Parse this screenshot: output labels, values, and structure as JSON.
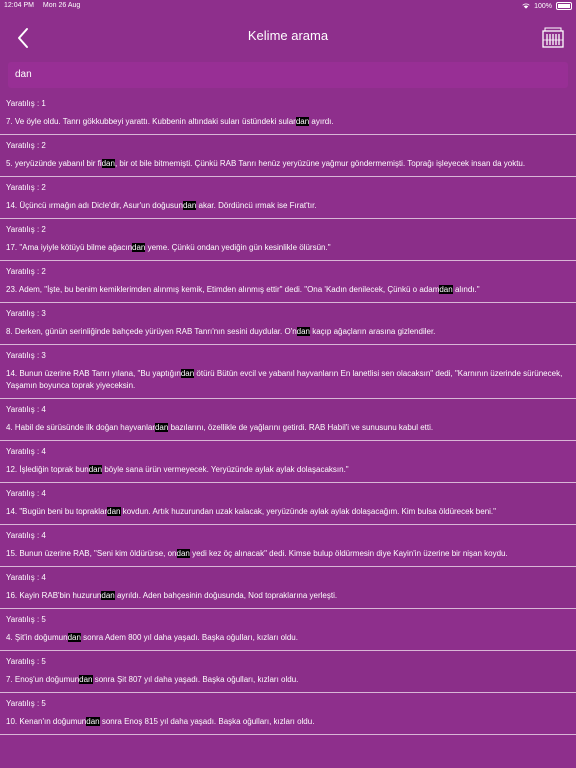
{
  "status": {
    "time": "12:04 PM",
    "date": "Mon 26 Aug",
    "battery": "100%"
  },
  "nav": {
    "title": "Kelime arama"
  },
  "search": {
    "value": "dan"
  },
  "results": [
    {
      "ref": "Yaratılış : 1",
      "pre": "7. Ve öyle oldu. Tanrı gökkubbeyi yarattı. Kubbenin altındaki suları üstündeki sular",
      "match": "dan",
      "post": " ayırdı."
    },
    {
      "ref": "Yaratılış : 2",
      "pre": "5. yeryüzünde yabanıl bir fi",
      "match": "dan",
      "post": ", bir ot bile bitmemişti. Çünkü RAB Tanrı henüz yeryüzüne yağmur göndermemişti. Toprağı işleyecek insan da yoktu."
    },
    {
      "ref": "Yaratılış : 2",
      "pre": "14. Üçüncü ırmağın adı Dicle'dir, Asur'un doğusun",
      "match": "dan",
      "post": " akar. Dördüncü ırmak ise Fırat'tır."
    },
    {
      "ref": "Yaratılış : 2",
      "pre": "17. \"Ama iyiyle kötüyü bilme ağacın",
      "match": "dan",
      "post": " yeme. Çünkü ondan yediğin gün kesinlikle ölürsün.\""
    },
    {
      "ref": "Yaratılış : 2",
      "pre": "23. Adem, \"İşte, bu benim kemiklerimden alınmış kemik, Etimden alınmış ettir\" dedi. \"Ona 'Kadın denilecek, Çünkü o adam",
      "match": "dan",
      "post": " alındı.\""
    },
    {
      "ref": "Yaratılış : 3",
      "pre": "8. Derken, günün serinliğinde bahçede yürüyen RAB Tanrı'nın sesini duydular. O'n",
      "match": "dan",
      "post": " kaçıp ağaçların arasına gizlendiler."
    },
    {
      "ref": "Yaratılış : 3",
      "pre": "14. Bunun üzerine RAB Tanrı yılana, \"Bu yaptığın",
      "match": "dan",
      "post": " ötürü Bütün evcil ve yabanıl hayvanların En lanetlisi sen olacaksın\" dedi, \"Karnının üzerinde sürünecek, Yaşamın boyunca toprak yiyeceksin."
    },
    {
      "ref": "Yaratılış : 4",
      "pre": "4. Habil de sürüsünde ilk doğan hayvanlar",
      "match": "dan",
      "post": " bazılarını, özellikle de yağlarını getirdi. RAB Habil'i ve sunusunu kabul etti."
    },
    {
      "ref": "Yaratılış : 4",
      "pre": "12. İşlediğin toprak bun",
      "match": "dan",
      "post": " böyle sana ürün vermeyecek. Yeryüzünde aylak aylak dolaşacaksın.\""
    },
    {
      "ref": "Yaratılış : 4",
      "pre": "14. \"Bugün beni bu topraklar",
      "match": "dan",
      "post": " kovdun. Artık huzurundan uzak kalacak, yeryüzünde aylak aylak dolaşacağım. Kim bulsa öldürecek beni.\""
    },
    {
      "ref": "Yaratılış : 4",
      "pre": "15. Bunun üzerine RAB, \"Seni kim öldürürse, on",
      "match": "dan",
      "post": " yedi kez öç alınacak\" dedi. Kimse bulup öldürmesin diye Kayin'in üzerine bir nişan koydu."
    },
    {
      "ref": "Yaratılış : 4",
      "pre": "16. Kayin RAB'bin huzurun",
      "match": "dan",
      "post": " ayrıldı. Aden bahçesinin doğusunda, Nod topraklarına yerleşti."
    },
    {
      "ref": "Yaratılış : 5",
      "pre": "4. Şit'in doğumun",
      "match": "dan",
      "post": " sonra Adem 800 yıl daha yaşadı. Başka oğulları, kızları oldu."
    },
    {
      "ref": "Yaratılış : 5",
      "pre": "7. Enoş'un doğumun",
      "match": "dan",
      "post": " sonra Şit 807 yıl daha yaşadı. Başka oğulları, kızları oldu."
    },
    {
      "ref": "Yaratılış : 5",
      "pre": "10. Kenan'ın doğumun",
      "match": "dan",
      "post": " sonra Enoş 815 yıl daha yaşadı. Başka oğulları, kızları oldu."
    }
  ]
}
